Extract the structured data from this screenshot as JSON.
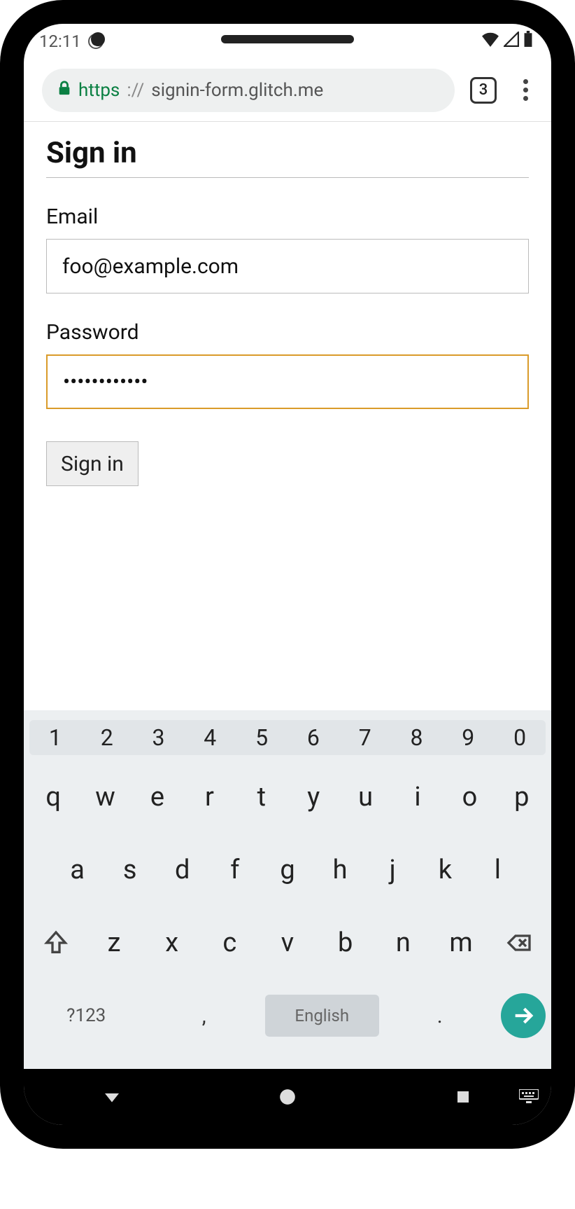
{
  "status": {
    "time": "12:11"
  },
  "browser": {
    "scheme": "https",
    "sep": "://",
    "host": "signin-form.glitch.me",
    "tab_count": "3"
  },
  "page": {
    "title": "Sign in",
    "email_label": "Email",
    "email_value": "foo@example.com",
    "password_label": "Password",
    "password_value": "••••••••••••",
    "submit_label": "Sign in"
  },
  "keyboard": {
    "numbers": [
      "1",
      "2",
      "3",
      "4",
      "5",
      "6",
      "7",
      "8",
      "9",
      "0"
    ],
    "row1": [
      "q",
      "w",
      "e",
      "r",
      "t",
      "y",
      "u",
      "i",
      "o",
      "p"
    ],
    "row2": [
      "a",
      "s",
      "d",
      "f",
      "g",
      "h",
      "j",
      "k",
      "l"
    ],
    "row3": [
      "z",
      "x",
      "c",
      "v",
      "b",
      "n",
      "m"
    ],
    "symbols_label": "?123",
    "comma": ",",
    "period": ".",
    "space_label": "English"
  }
}
